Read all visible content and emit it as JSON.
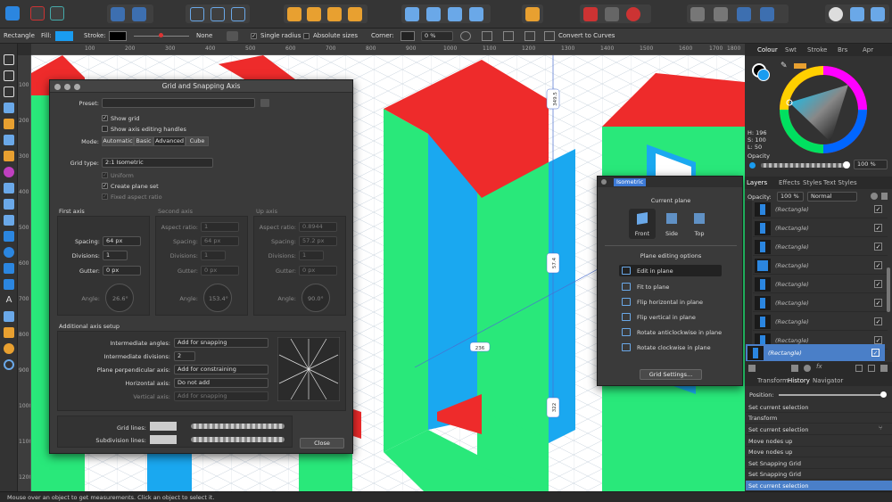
{
  "context_toolbar": {
    "tool_name": "Rectangle",
    "fill_label": "Fill:",
    "fill_color": "#1a9cf0",
    "stroke_label": "Stroke:",
    "stroke_color": "#000000",
    "stroke_value": "None",
    "single_radius": "Single radius",
    "absolute_sizes": "Absolute sizes",
    "corner_label": "Corner:",
    "corner_value": "0 %",
    "convert_to_curves": "Convert to Curves"
  },
  "ruler": {
    "h_ticks": [
      "100",
      "200",
      "300",
      "400",
      "500",
      "600",
      "700",
      "800",
      "900",
      "1000",
      "1100",
      "1200",
      "1300",
      "1400",
      "1500",
      "1600",
      "1700",
      "1800"
    ],
    "v_ticks": [
      "100",
      "200",
      "300",
      "400",
      "500",
      "600",
      "700",
      "800",
      "900",
      "1000",
      "1100",
      "1200"
    ]
  },
  "canvas": {
    "dim_labels": [
      "349.5",
      "57.4",
      "236",
      "322"
    ],
    "colors": {
      "green": "#29e87a",
      "blue": "#1aa8f0",
      "red": "#ee2b2b"
    }
  },
  "status_bar": {
    "text": "Mouse over an object to get measurements. Click an object to select it."
  },
  "dialog": {
    "title": "Grid and Snapping Axis",
    "preset_label": "Preset:",
    "show_grid": "Show grid",
    "show_axis_handles": "Show axis editing handles",
    "mode_label": "Mode:",
    "modes": [
      "Automatic",
      "Basic",
      "Advanced",
      "Cube"
    ],
    "grid_type_label": "Grid type:",
    "grid_type_value": "2:1 Isometric",
    "uniform": "Uniform",
    "create_plane_set": "Create plane set",
    "fixed_aspect_ratio": "Fixed aspect ratio",
    "first_axis": {
      "title": "First axis",
      "spacing_label": "Spacing:",
      "spacing": "64 px",
      "divisions_label": "Divisions:",
      "divisions": "1",
      "gutter_label": "Gutter:",
      "gutter": "0 px",
      "angle_label": "Angle:",
      "angle": "26.6°"
    },
    "second_axis": {
      "title": "Second axis",
      "aspect_label": "Aspect ratio:",
      "aspect": "1",
      "spacing_label": "Spacing:",
      "spacing": "64 px",
      "divisions_label": "Divisions:",
      "divisions": "1",
      "gutter_label": "Gutter:",
      "gutter": "0 px",
      "angle_label": "Angle:",
      "angle": "153.4°"
    },
    "up_axis": {
      "title": "Up axis",
      "aspect_label": "Aspect ratio:",
      "aspect": "0.8944",
      "spacing_label": "Spacing:",
      "spacing": "57.2 px",
      "divisions_label": "Divisions:",
      "divisions": "1",
      "gutter_label": "Gutter:",
      "gutter": "0 px",
      "angle_label": "Angle:",
      "angle": "90.0°"
    },
    "additional_title": "Additional axis setup",
    "intermediate_angles_label": "Intermediate angles:",
    "intermediate_angles": "Add for snapping",
    "intermediate_divisions_label": "Intermediate divisions:",
    "intermediate_divisions": "2",
    "plane_perp_label": "Plane perpendicular axis:",
    "plane_perp": "Add for constraining",
    "horizontal_axis_label": "Horizontal axis:",
    "horizontal_axis": "Do not add",
    "vertical_axis_label": "Vertical axis:",
    "vertical_axis": "Add for snapping",
    "grid_lines_label": "Grid lines:",
    "subdivision_lines_label": "Subdivision lines:",
    "close_label": "Close"
  },
  "isometric_panel": {
    "title": "Isometric",
    "current_plane": "Current plane",
    "planes": [
      "Front",
      "Side",
      "Top"
    ],
    "plane_options_title": "Plane editing options",
    "options": [
      "Edit in plane",
      "Fit to plane",
      "Flip horizontal in plane",
      "Flip vertical in plane",
      "Rotate anticlockwise in plane",
      "Rotate clockwise in plane"
    ],
    "grid_settings": "Grid Settings..."
  },
  "right_panel": {
    "tabs_top": [
      "Colour",
      "Swt",
      "Stroke",
      "Brs",
      "Apr"
    ],
    "hsl": {
      "h": "H: 196",
      "s": "S: 100",
      "l": "L: 50"
    },
    "opacity_label": "Opacity",
    "opacity_value": "100 %",
    "tabs_mid": [
      "Layers",
      "Effects",
      "Styles",
      "Text Styles"
    ],
    "layers_opacity_label": "Opacity:",
    "layers_opacity": "100 %",
    "blend_mode": "Normal",
    "layers": [
      "(Rectangle)",
      "(Rectangle)",
      "(Rectangle)",
      "(Rectangle)",
      "(Rectangle)",
      "(Rectangle)",
      "(Rectangle)",
      "(Rectangle)"
    ],
    "tabs_bottom": [
      "Transform",
      "History",
      "Navigator"
    ],
    "position_label": "Position:",
    "history": [
      "Set current selection",
      "Transform",
      "Set current selection",
      "Move nodes up",
      "Move nodes up",
      "Set Snapping Grid",
      "Set Snapping Grid",
      "Set current selection"
    ]
  }
}
